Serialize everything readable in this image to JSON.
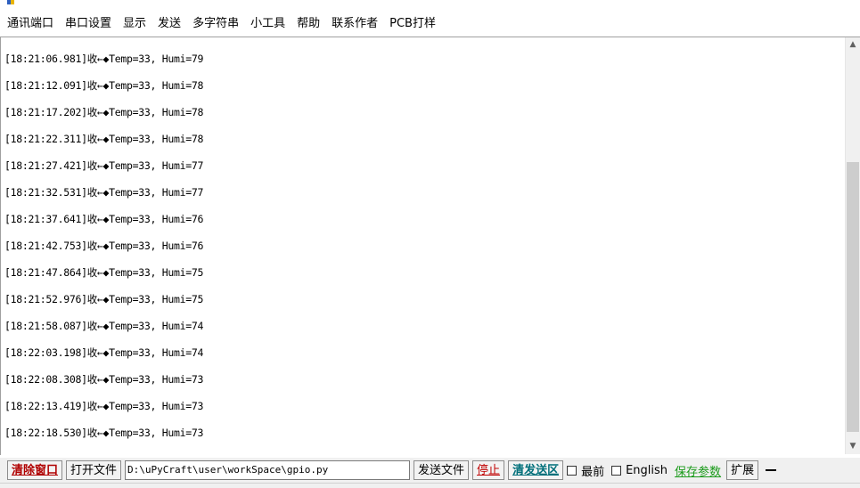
{
  "menu": {
    "items": [
      "通讯端口",
      "串口设置",
      "显示",
      "发送",
      "多字符串",
      "小工具",
      "帮助",
      "联系作者",
      "PCB打样"
    ]
  },
  "log": {
    "lines": [
      "[18:21:06.981]收←◆Temp=33, Humi=79",
      "[18:21:12.091]收←◆Temp=33, Humi=78",
      "[18:21:17.202]收←◆Temp=33, Humi=78",
      "[18:21:22.311]收←◆Temp=33, Humi=78",
      "[18:21:27.421]收←◆Temp=33, Humi=77",
      "[18:21:32.531]收←◆Temp=33, Humi=77",
      "[18:21:37.641]收←◆Temp=33, Humi=76",
      "[18:21:42.753]收←◆Temp=33, Humi=76",
      "[18:21:47.864]收←◆Temp=33, Humi=75",
      "[18:21:52.976]收←◆Temp=33, Humi=75",
      "[18:21:58.087]收←◆Temp=33, Humi=74",
      "[18:22:03.198]收←◆Temp=33, Humi=74",
      "[18:22:08.308]收←◆Temp=33, Humi=73",
      "[18:22:13.419]收←◆Temp=33, Humi=73",
      "[18:22:18.530]收←◆Temp=33, Humi=73"
    ]
  },
  "toolbar": {
    "clear_window": "清除窗口",
    "open_file": "打开文件",
    "file_path": "D:\\uPyCraft\\user\\workSpace\\gpio.py",
    "send_file": "发送文件",
    "stop": "停止",
    "clear_send": "清发送区",
    "topmost": "最前",
    "english": "English",
    "save_params": "保存参数",
    "expand": "扩展"
  }
}
